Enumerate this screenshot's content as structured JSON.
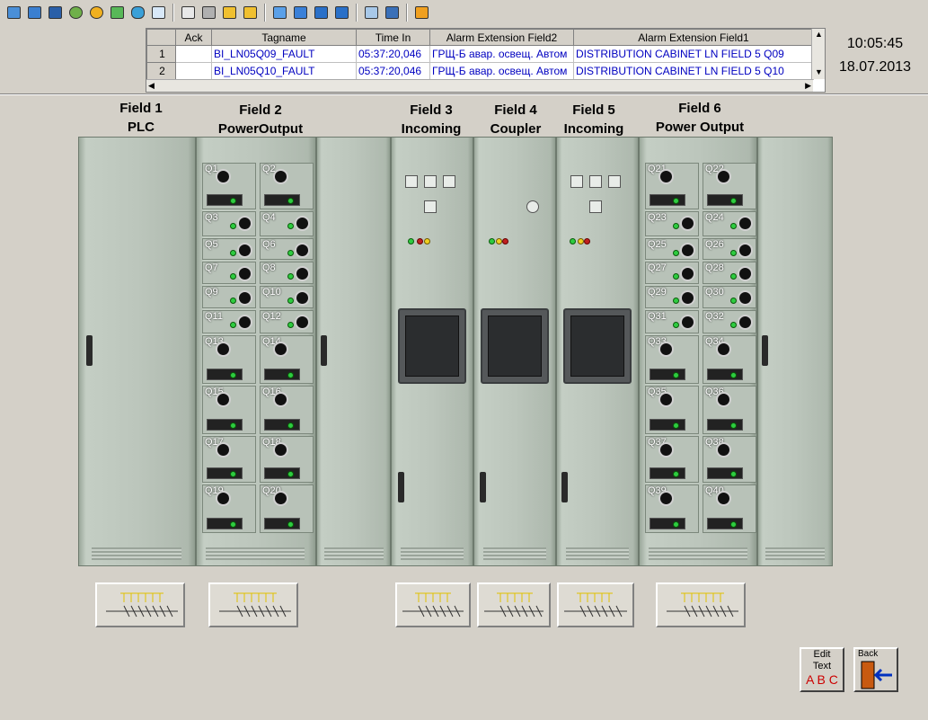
{
  "toolbar": {
    "icons": [
      "screen-icon",
      "window-icon",
      "terminal-icon",
      "exchange-icon",
      "alarm-icon",
      "refresh-icon",
      "phone-icon",
      "message-icon",
      "user-up-icon",
      "network-icon",
      "lock-icon",
      "lock-up-icon",
      "fullscreen-icon",
      "zoom-fit-icon",
      "screen-blue-icon",
      "zoom-icon",
      "copy-window-icon",
      "tools-icon",
      "close-icon"
    ]
  },
  "alarm_table": {
    "headers": [
      "Ack",
      "Tagname",
      "Time In",
      "Alarm Extension Field2",
      "Alarm Extension Field1"
    ],
    "rows": [
      {
        "num": "1",
        "ack": "",
        "tag": "BI_LN05Q09_FAULT",
        "time": "05:37:20,046",
        "f2": "ГРЩ-Б авар. освещ. Автом",
        "f1": "DISTRIBUTION CABINET LN FIELD 5 Q09"
      },
      {
        "num": "2",
        "ack": "",
        "tag": "BI_LN05Q10_FAULT",
        "time": "05:37:20,046",
        "f2": "ГРЩ-Б авар. освещ. Автом",
        "f1": "DISTRIBUTION CABINET LN FIELD 5 Q10"
      }
    ]
  },
  "clock": {
    "time": "10:05:45",
    "date": "18.07.2013"
  },
  "fields": [
    {
      "line1": "Field 1",
      "line2": "PLC"
    },
    {
      "line1": "Field 2",
      "line2": "PowerOutput"
    },
    {
      "line1": "Field 3",
      "line2": "Incoming"
    },
    {
      "line1": "Field 4",
      "line2": "Coupler"
    },
    {
      "line1": "Field 5",
      "line2": "Incoming"
    },
    {
      "line1": "Field 6",
      "line2": "Power Output"
    }
  ],
  "field2_breakers": [
    "Q1",
    "Q2",
    "Q3",
    "Q4",
    "Q5",
    "Q6",
    "Q7",
    "Q8",
    "Q9",
    "Q10",
    "Q11",
    "Q12",
    "Q13",
    "Q14",
    "Q15",
    "Q16",
    "Q17",
    "Q18",
    "Q19",
    "Q20"
  ],
  "field6_breakers": [
    "Q21",
    "Q22",
    "Q23",
    "Q24",
    "Q25",
    "Q26",
    "Q27",
    "Q28",
    "Q29",
    "Q30",
    "Q31",
    "Q32",
    "Q33",
    "Q34",
    "Q35",
    "Q36",
    "Q37",
    "Q38",
    "Q39",
    "Q40"
  ],
  "buttons": {
    "edit_line1": "Edit",
    "edit_line2": "Text",
    "edit_abc": "A B C",
    "back": "Back"
  },
  "colors": {
    "alarm_text": "#0000c0",
    "led_green": "#2ecc40",
    "cabinet": "#bcc6bc"
  }
}
